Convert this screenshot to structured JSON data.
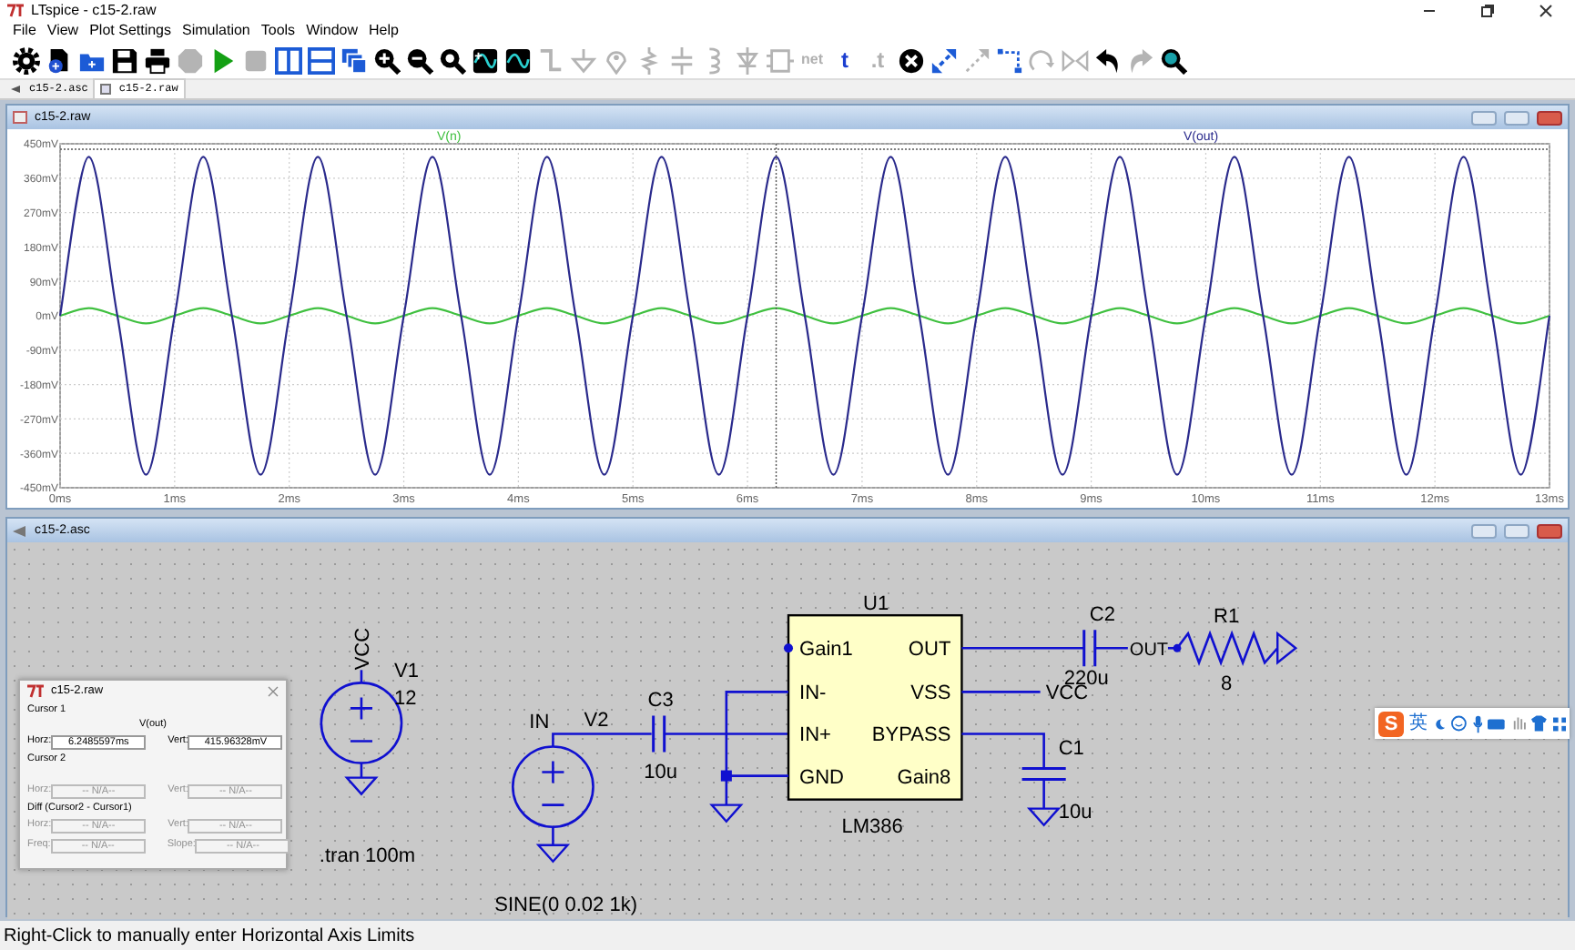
{
  "window": {
    "title": "LTspice - c15-2.raw"
  },
  "menu": [
    "File",
    "View",
    "Plot Settings",
    "Simulation",
    "Tools",
    "Window",
    "Help"
  ],
  "toolbar": [
    {
      "kind": "gear",
      "disabled": false
    },
    {
      "kind": "new",
      "disabled": false
    },
    {
      "kind": "open",
      "disabled": false
    },
    {
      "kind": "save",
      "disabled": false
    },
    {
      "kind": "print",
      "disabled": false
    },
    {
      "kind": "halt",
      "disabled": true
    },
    {
      "kind": "run",
      "disabled": false
    },
    {
      "kind": "stop",
      "disabled": true
    },
    {
      "kind": "tilev",
      "disabled": false
    },
    {
      "kind": "tileh",
      "disabled": false
    },
    {
      "kind": "cascade",
      "disabled": false
    },
    {
      "kind": "zoomin",
      "disabled": false
    },
    {
      "kind": "zoomout",
      "disabled": false
    },
    {
      "kind": "zoomfit",
      "disabled": false
    },
    {
      "kind": "autorange",
      "disabled": false
    },
    {
      "kind": "wave",
      "disabled": false
    },
    {
      "kind": "wire",
      "disabled": true
    },
    {
      "kind": "ground",
      "disabled": true
    },
    {
      "kind": "label",
      "disabled": true
    },
    {
      "kind": "resistor",
      "disabled": true
    },
    {
      "kind": "capacitor",
      "disabled": true
    },
    {
      "kind": "inductor",
      "disabled": true
    },
    {
      "kind": "diode",
      "disabled": true
    },
    {
      "kind": "component",
      "disabled": true
    },
    {
      "kind": "text",
      "label": "net",
      "disabled": true
    },
    {
      "kind": "text",
      "label": "t",
      "disabled": false
    },
    {
      "kind": "text",
      "label": ".t",
      "disabled": true
    },
    {
      "kind": "delete",
      "disabled": false
    },
    {
      "kind": "move",
      "disabled": false
    },
    {
      "kind": "drag",
      "disabled": true
    },
    {
      "kind": "drawline",
      "disabled": false
    },
    {
      "kind": "rotate",
      "disabled": true
    },
    {
      "kind": "mirror",
      "disabled": true
    },
    {
      "kind": "undo",
      "disabled": false
    },
    {
      "kind": "redo",
      "disabled": true
    },
    {
      "kind": "find",
      "disabled": false
    }
  ],
  "tabs": [
    {
      "label": "c15-2.asc",
      "kind": "schematic",
      "selected": false
    },
    {
      "label": "c15-2.raw",
      "kind": "waveform",
      "selected": true
    }
  ],
  "plot": {
    "title": "c15-2.raw",
    "chart_data": {
      "type": "line",
      "x": [
        0,
        0.25,
        0.5,
        0.75,
        1,
        1.25,
        1.5,
        1.75,
        2,
        2.25,
        2.5,
        2.75,
        3,
        3.25,
        3.5,
        3.75,
        4,
        4.25,
        4.5,
        4.75,
        5,
        5.25,
        5.5,
        5.75,
        6,
        6.25,
        6.5,
        6.75,
        7,
        7.25,
        7.5,
        7.75,
        8,
        8.25,
        8.5,
        8.75,
        9,
        9.25,
        9.5,
        9.75,
        10,
        10.25,
        10.5,
        10.75,
        11,
        11.25,
        11.5,
        11.75,
        12,
        12.25,
        12.5,
        12.75,
        13
      ],
      "series": [
        {
          "name": "V(n)",
          "color": "#40c040",
          "values": [
            0,
            20,
            0,
            -20,
            0,
            20,
            0,
            -20,
            0,
            20,
            0,
            -20,
            0,
            20,
            0,
            -20,
            0,
            20,
            0,
            -20,
            0,
            20,
            0,
            -20,
            0,
            20,
            0,
            -20,
            0,
            20,
            0,
            -20,
            0,
            20,
            0,
            -20,
            0,
            20,
            0,
            -20,
            0,
            20,
            0,
            -20,
            0,
            20,
            0,
            -20,
            0,
            20,
            0,
            -20,
            0
          ]
        },
        {
          "name": "V(out)",
          "color": "#2a2a8c",
          "values": [
            0,
            416,
            0,
            -416,
            0,
            416,
            0,
            -416,
            0,
            416,
            0,
            -416,
            0,
            416,
            0,
            -416,
            0,
            416,
            0,
            -416,
            0,
            416,
            0,
            -416,
            0,
            416,
            0,
            -416,
            0,
            416,
            0,
            -416,
            0,
            416,
            0,
            -416,
            0,
            416,
            0,
            -416,
            0,
            416,
            0,
            -416,
            0,
            416,
            0,
            -416,
            0,
            416,
            0,
            -416,
            0
          ]
        }
      ],
      "xlim": [
        0,
        13
      ],
      "ylim": [
        -450,
        450
      ],
      "xticks": [
        {
          "value": 0,
          "label": "0ms"
        },
        {
          "value": 1,
          "label": "1ms"
        },
        {
          "value": 2,
          "label": "2ms"
        },
        {
          "value": 3,
          "label": "3ms"
        },
        {
          "value": 4,
          "label": "4ms"
        },
        {
          "value": 5,
          "label": "5ms"
        },
        {
          "value": 6,
          "label": "6ms"
        },
        {
          "value": 7,
          "label": "7ms"
        },
        {
          "value": 8,
          "label": "8ms"
        },
        {
          "value": 9,
          "label": "9ms"
        },
        {
          "value": 10,
          "label": "10ms"
        },
        {
          "value": 11,
          "label": "11ms"
        },
        {
          "value": 12,
          "label": "12ms"
        },
        {
          "value": 13,
          "label": "13ms"
        }
      ],
      "yticks": [
        {
          "value": 450,
          "label": "450mV"
        },
        {
          "value": 360,
          "label": "360mV"
        },
        {
          "value": 270,
          "label": "270mV"
        },
        {
          "value": 180,
          "label": "180mV"
        },
        {
          "value": 90,
          "label": "90mV"
        },
        {
          "value": 0,
          "label": "0mV"
        },
        {
          "value": -90,
          "label": "-90mV"
        },
        {
          "value": -180,
          "label": "-180mV"
        },
        {
          "value": -270,
          "label": "-270mV"
        },
        {
          "value": -360,
          "label": "-360mV"
        },
        {
          "value": -450,
          "label": "-450mV"
        }
      ],
      "grid": true
    }
  },
  "schematic": {
    "title": "c15-2.asc",
    "v1": {
      "name": "V1",
      "value": "12",
      "net": "VCC"
    },
    "v2": {
      "name": "V2",
      "net": "IN",
      "value": "SINE(0 0.02 1k)"
    },
    "c3": {
      "name": "C3",
      "value": "10u"
    },
    "u1": {
      "name": "U1",
      "model": "LM386",
      "pins_left": [
        "Gain1",
        "IN-",
        "IN+",
        "GND"
      ],
      "pins_right": [
        "OUT",
        "VSS",
        "BYPASS",
        "Gain8"
      ]
    },
    "c2": {
      "name": "C2",
      "value": "220u"
    },
    "out_label": "OUT",
    "r1": {
      "name": "R1",
      "value": "8"
    },
    "vcc_label": "VCC",
    "c1": {
      "name": "C1",
      "value": "10u"
    },
    "directive": ".tran 100m"
  },
  "cursor_dialog": {
    "title": "c15-2.raw",
    "cursor1": {
      "heading": "Cursor 1",
      "trace": "V(out)",
      "disabled": false,
      "fields": [
        {
          "label": "Horz:",
          "value": "6.2485597ms"
        },
        {
          "label": "Vert:",
          "value": "415.96328mV"
        }
      ]
    },
    "cursor2": {
      "heading": "Cursor 2",
      "disabled": true,
      "fields": [
        {
          "label": "Horz:",
          "value": "-- N/A--"
        },
        {
          "label": "Vert:",
          "value": "-- N/A--"
        }
      ]
    },
    "diff": {
      "heading": "Diff (Cursor2 - Cursor1)",
      "disabled": true,
      "fields": [
        {
          "label": "Horz:",
          "value": "-- N/A--"
        },
        {
          "label": "Vert:",
          "value": "-- N/A--"
        },
        {
          "label": "Freq:",
          "value": "-- N/A--"
        },
        {
          "label": "Slope:",
          "value": "-- N/A--"
        }
      ]
    }
  },
  "ime_toolbar": {
    "logo": "S",
    "language": "英"
  },
  "status_bar": "Right-Click to manually enter Horizontal Axis Limits"
}
